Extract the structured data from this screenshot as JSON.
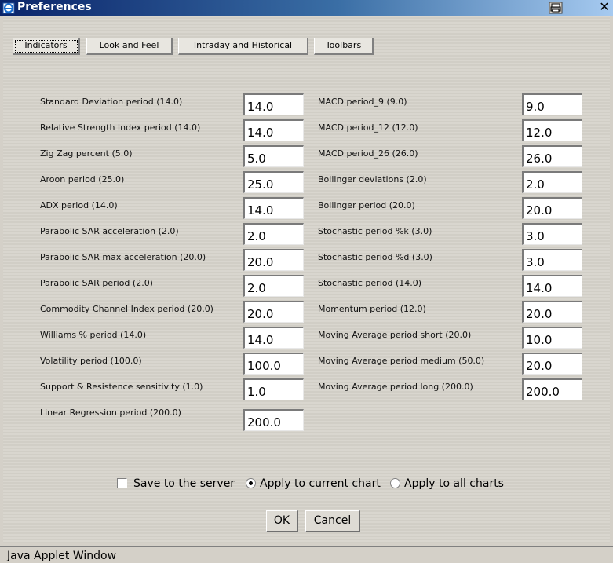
{
  "window": {
    "title": "Preferences",
    "close_glyph": "✕"
  },
  "tabs": [
    {
      "label": "Indicators",
      "active": true
    },
    {
      "label": "Look and Feel"
    },
    {
      "label": "Intraday and Historical"
    },
    {
      "label": "Toolbars"
    }
  ],
  "left_fields": [
    {
      "label": "Standard Deviation period (14.0)",
      "value": "14.0"
    },
    {
      "label": "Relative Strength Index period (14.0)",
      "value": "14.0"
    },
    {
      "label": "Zig Zag percent (5.0)",
      "value": "5.0"
    },
    {
      "label": "Aroon period (25.0)",
      "value": "25.0"
    },
    {
      "label": "ADX period (14.0)",
      "value": "14.0"
    },
    {
      "label": "Parabolic SAR acceleration (2.0)",
      "value": "2.0"
    },
    {
      "label": "Parabolic SAR max acceleration (20.0)",
      "value": "20.0"
    },
    {
      "label": "Parabolic SAR period (2.0)",
      "value": "2.0"
    },
    {
      "label": "Commodity Channel Index period (20.0)",
      "value": "20.0"
    },
    {
      "label": "Williams % period (14.0)",
      "value": "14.0"
    },
    {
      "label": "Volatility period (100.0)",
      "value": "100.0"
    },
    {
      "label": "Support & Resistence sensitivity (1.0)",
      "value": "1.0"
    },
    {
      "label": "Linear Regression period (200.0)",
      "value": "200.0"
    }
  ],
  "right_fields": [
    {
      "label": "MACD period_9 (9.0)",
      "value": "9.0"
    },
    {
      "label": "MACD period_12 (12.0)",
      "value": "12.0"
    },
    {
      "label": "MACD period_26 (26.0)",
      "value": "26.0"
    },
    {
      "label": "Bollinger deviations (2.0)",
      "value": "2.0"
    },
    {
      "label": "Bollinger period (20.0)",
      "value": "20.0"
    },
    {
      "label": "Stochastic period %k (3.0)",
      "value": "3.0"
    },
    {
      "label": "Stochastic period %d (3.0)",
      "value": "3.0"
    },
    {
      "label": "Stochastic period (14.0)",
      "value": "14.0"
    },
    {
      "label": "Momentum period (12.0)",
      "value": "20.0"
    },
    {
      "label": "Moving Average period short (20.0)",
      "value": "10.0"
    },
    {
      "label": "Moving Average period medium (50.0)",
      "value": "20.0"
    },
    {
      "label": "Moving Average period long (200.0)",
      "value": "200.0"
    }
  ],
  "options": {
    "save_server": {
      "label": "Save to the server",
      "checked": false
    },
    "apply_current": {
      "label": "Apply to current chart",
      "selected": true
    },
    "apply_all": {
      "label": "Apply to all charts",
      "selected": false
    }
  },
  "buttons": {
    "ok": "OK",
    "cancel": "Cancel"
  },
  "status": {
    "text": "Java Applet Window"
  },
  "icons": {
    "app": "explorer-icon",
    "print": "printer-icon",
    "close": "close-icon"
  }
}
